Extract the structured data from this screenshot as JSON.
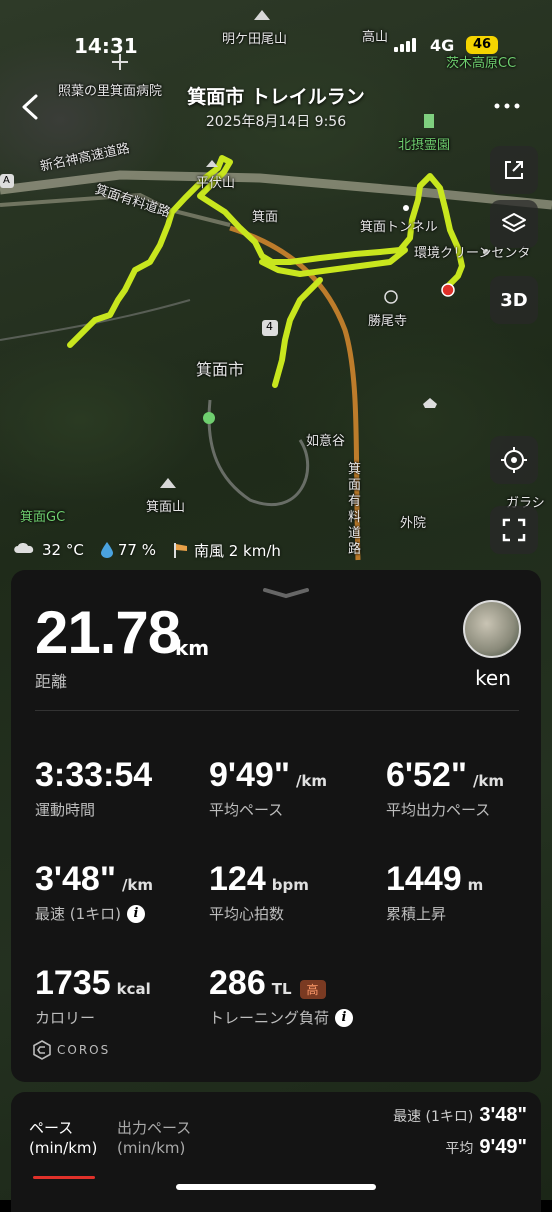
{
  "status_bar": {
    "time": "14:31",
    "network": "4G",
    "battery": "46"
  },
  "header": {
    "title": "箕面市 トレイルラン",
    "subtitle": "2025年8月14日 9:56"
  },
  "map": {
    "labels": {
      "myogadaruyama": "明ケ田尾山",
      "takayama": "高山",
      "ibarakikogen_cc": "茨木高原CC",
      "terunoha": "照葉の里箕面病院",
      "shin_meishin": "新名神高速道路",
      "minoh_yuryo": "箕面有料道路",
      "hokusetsu_reien": "北摂霊園",
      "minoh": "箕面",
      "minoh_tunnel": "箕面トンネル",
      "kankyo_clean": "環境クリーンセンタ",
      "katsuoji": "勝尾寺",
      "minoh_city": "箕面市",
      "nyoidani": "如意谷",
      "minoh_yuryo_v": "箕面有料道路",
      "minohyama": "箕面山",
      "minoh_gc": "箕面GC",
      "soto_in": "外院",
      "garashi": "ガラシ",
      "route_no": "4",
      "highway_mark": "A",
      "hiraoka_fragment": "平伏山"
    },
    "route_color": "#c8e61e",
    "end_marker_color": "#e0312a"
  },
  "weather": {
    "temp": "32 °C",
    "humidity": "77 %",
    "wind": "南風 2 km/h"
  },
  "summary": {
    "distance": "21.78",
    "distance_unit": "km",
    "distance_label": "距離",
    "user_name": "ken"
  },
  "stats": {
    "duration": {
      "value": "3:33:54",
      "unit": "",
      "label": "運動時間"
    },
    "avg_pace": {
      "value": "9'49\"",
      "unit": "/km",
      "label": "平均ペース"
    },
    "avg_power_pace": {
      "value": "6'52\"",
      "unit": "/km",
      "label": "平均出力ペース"
    },
    "best_km": {
      "value": "3'48\"",
      "unit": "/km",
      "label": "最速 (1キロ)"
    },
    "avg_hr": {
      "value": "124",
      "unit": "bpm",
      "label": "平均心拍数"
    },
    "ascent": {
      "value": "1449",
      "unit": "m",
      "label": "累積上昇"
    },
    "calories": {
      "value": "1735",
      "unit": "kcal",
      "label": "カロリー"
    },
    "training_load": {
      "value": "286",
      "unit": "TL",
      "badge": "高",
      "label": "トレーニング負荷"
    }
  },
  "brand": "COROS",
  "bottom": {
    "tab_pace_line1": "ペース",
    "tab_pace_line2": "(min/km)",
    "tab_power_line1": "出力ペース",
    "tab_power_line2": "(min/km)",
    "best_label": "最速 (1キロ)",
    "best_value": "3'48\"",
    "avg_label": "平均",
    "avg_value": "9'49\""
  }
}
